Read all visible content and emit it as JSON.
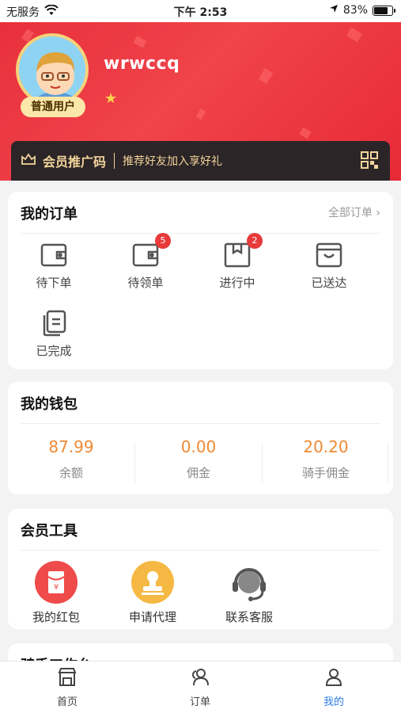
{
  "status_bar": {
    "carrier": "无服务",
    "time": "下午 2:53",
    "battery": "83%",
    "battery_level": 0.83
  },
  "profile": {
    "username": "wrwccq",
    "member_level": "普通用户"
  },
  "promo": {
    "title": "会员推广码",
    "subtitle": "推荐好友加入享好礼"
  },
  "orders": {
    "title": "我的订单",
    "all_label": "全部订单",
    "items": [
      {
        "label": "待下单",
        "icon": "wallet-icon",
        "badge": ""
      },
      {
        "label": "待领单",
        "icon": "wallet-icon",
        "badge": "5"
      },
      {
        "label": "进行中",
        "icon": "box-icon",
        "badge": "2"
      },
      {
        "label": "已送达",
        "icon": "bag-icon",
        "badge": ""
      },
      {
        "label": "已完成",
        "icon": "documents-icon",
        "badge": ""
      }
    ]
  },
  "wallet": {
    "title": "我的钱包",
    "items": [
      {
        "value": "87.99",
        "label": "余额"
      },
      {
        "value": "0.00",
        "label": "佣金"
      },
      {
        "value": "20.20",
        "label": "骑手佣金"
      }
    ]
  },
  "tools": {
    "title": "会员工具",
    "items": [
      {
        "label": "我的红包",
        "icon": "red-envelope-icon",
        "color": "#ef4b4b"
      },
      {
        "label": "申请代理",
        "icon": "stamp-icon",
        "color": "#f5b943"
      },
      {
        "label": "联系客服",
        "icon": "headset-icon",
        "color": "#555555"
      }
    ]
  },
  "next_section": {
    "title": "骑手工作台"
  },
  "tabbar": {
    "items": [
      {
        "label": "首页",
        "icon": "store-icon"
      },
      {
        "label": "订单",
        "icon": "people-icon"
      },
      {
        "label": "我的",
        "icon": "person-icon",
        "active": true
      }
    ]
  },
  "colors": {
    "header_red": "#e8303c",
    "accent_blue": "#2f7de1",
    "wallet_orange": "#f08a34"
  }
}
